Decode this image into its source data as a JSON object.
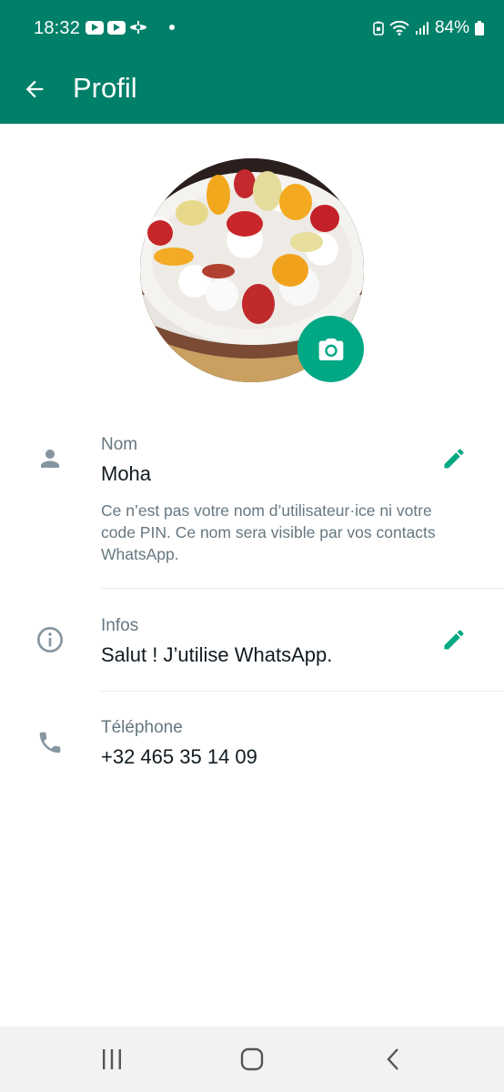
{
  "status_bar": {
    "time": "18:32",
    "battery": "84%",
    "icons": [
      "youtube-icon",
      "youtube-icon",
      "airplane-app-icon",
      "notification-dot",
      "battery-saver-icon",
      "wifi-icon",
      "signal-icon",
      "battery-icon"
    ]
  },
  "app_bar": {
    "title": "Profil",
    "back_icon": "arrow-left-icon"
  },
  "profile": {
    "avatar_icon": "cake-photo",
    "camera_icon": "camera-icon"
  },
  "fields": {
    "name": {
      "icon": "person-icon",
      "label": "Nom",
      "value": "Moha",
      "help": "Ce n’est pas votre nom d’utilisateur·ice ni votre code PIN. Ce nom sera visible par vos contacts WhatsApp."
    },
    "about": {
      "icon": "info-icon",
      "label": "Infos",
      "value": "Salut ! J’utilise WhatsApp."
    },
    "phone": {
      "icon": "phone-icon",
      "label": "Téléphone",
      "value": "+32 465 35 14 09"
    }
  },
  "colors": {
    "primary": "#008069",
    "accent": "#00a884",
    "secondary_text": "#667781"
  },
  "nav_bar": {
    "icons": [
      "recents-icon",
      "home-icon",
      "back-icon"
    ]
  }
}
